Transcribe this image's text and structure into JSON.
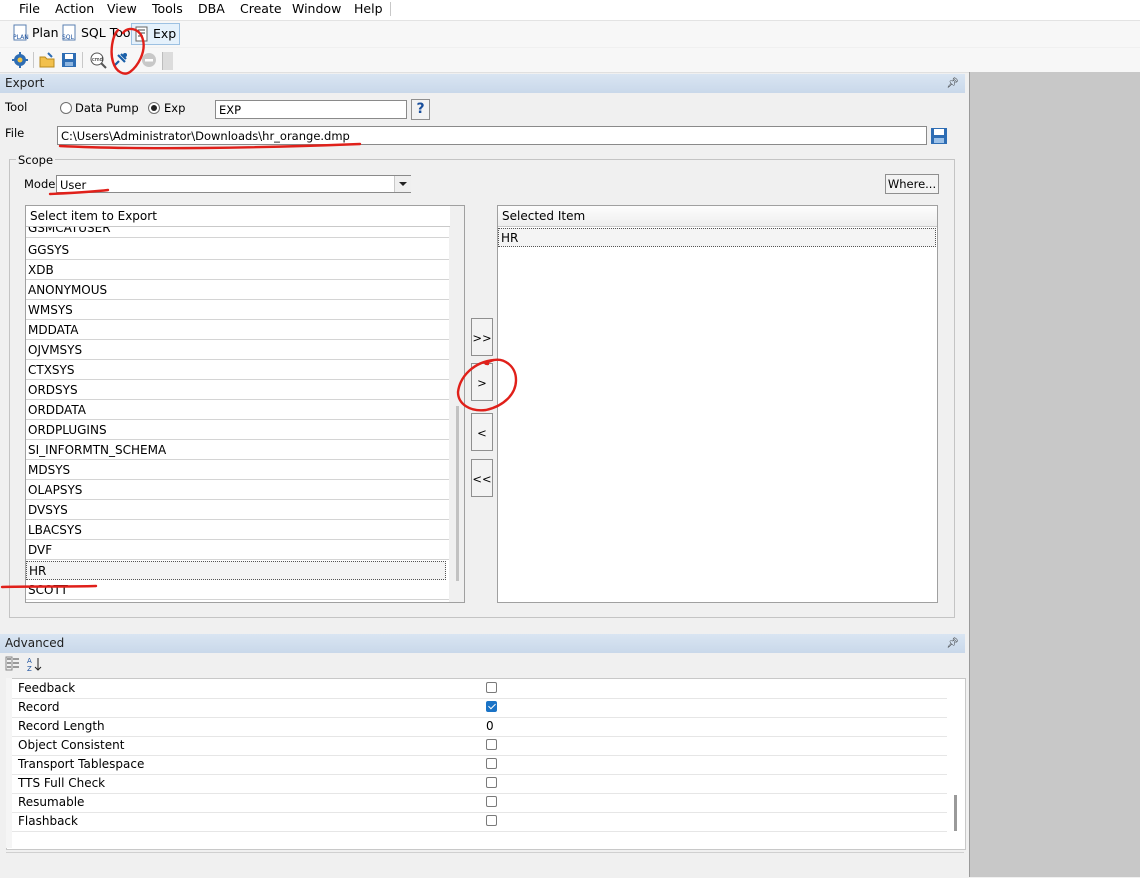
{
  "menu": [
    "File",
    "Action",
    "View",
    "Tools",
    "DBA",
    "Create",
    "Window",
    "Help"
  ],
  "tabs": [
    {
      "label": "Plan",
      "icon": "plan-icon"
    },
    {
      "label": "SQL Tool",
      "icon": "sql-icon"
    },
    {
      "label": "Exp",
      "icon": "exp-icon",
      "active": true
    }
  ],
  "export": {
    "header": "Export",
    "tool_label": "Tool",
    "tool_options": [
      "Data Pump",
      "Exp"
    ],
    "tool_selected": "Exp",
    "tool_value": "EXP",
    "help_label": "?",
    "file_label": "File",
    "file_value": "C:\\Users\\Administrator\\Downloads\\hr_orange.dmp"
  },
  "scope": {
    "label": "Scope",
    "mode_label": "Mode",
    "mode_value": "User",
    "where_label": "Where...",
    "left_header": "Select item to Export",
    "right_header": "Selected Item",
    "available": [
      "GSMCATUSER",
      "GGSYS",
      "XDB",
      "ANONYMOUS",
      "WMSYS",
      "MDDATA",
      "OJVMSYS",
      "CTXSYS",
      "ORDSYS",
      "ORDDATA",
      "ORDPLUGINS",
      "SI_INFORMTN_SCHEMA",
      "MDSYS",
      "OLAPSYS",
      "DVSYS",
      "LBACSYS",
      "DVF",
      "HR",
      "SCOTT"
    ],
    "selected": [
      "HR"
    ],
    "move_buttons": [
      ">>",
      ">",
      "<",
      "<<"
    ]
  },
  "advanced": {
    "header": "Advanced",
    "properties": [
      {
        "name": "Feedback",
        "type": "check",
        "value": false
      },
      {
        "name": "Record",
        "type": "check",
        "value": true
      },
      {
        "name": "Record Length",
        "type": "text",
        "value": "0"
      },
      {
        "name": "Object Consistent",
        "type": "check",
        "value": false
      },
      {
        "name": "Transport Tablespace",
        "type": "check",
        "value": false
      },
      {
        "name": "TTS Full Check",
        "type": "check",
        "value": false
      },
      {
        "name": "Resumable",
        "type": "check",
        "value": false
      },
      {
        "name": "Flashback",
        "type": "check",
        "value": false
      }
    ]
  },
  "colors": {
    "accent": "#1a73c6",
    "annotation": "#e0201a",
    "header": "#ccdaeb"
  }
}
